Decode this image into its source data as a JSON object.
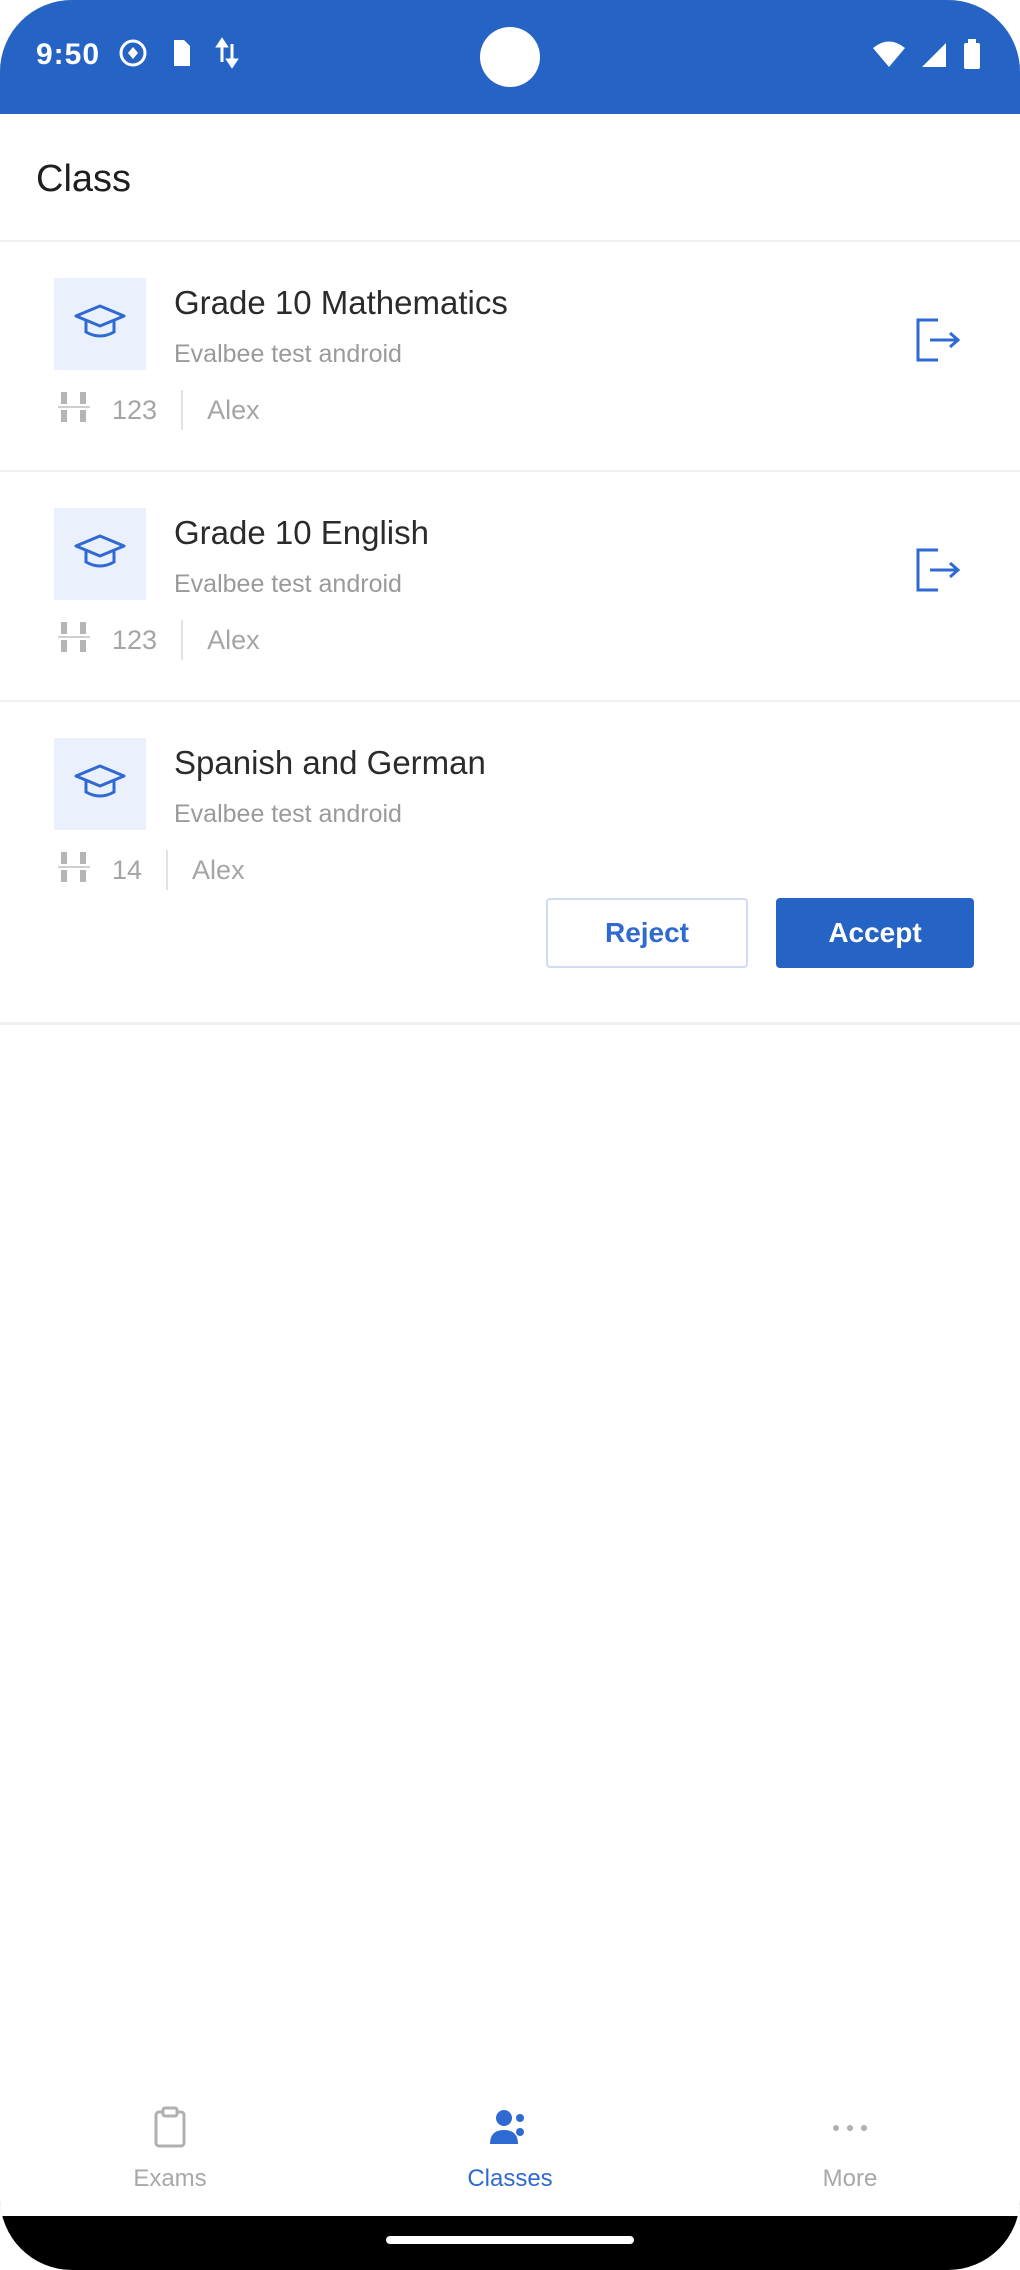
{
  "status_bar": {
    "time": "9:50",
    "bg_color": "#2563c4",
    "left_icons": [
      "vpn-icon",
      "sim-icon",
      "data-icon"
    ],
    "right_icons": [
      "wifi-icon",
      "signal-icon",
      "battery-icon"
    ]
  },
  "header": {
    "title": "Class"
  },
  "classes": [
    {
      "name": "Grade 10 Mathematics",
      "subtitle": "Evalbee test android",
      "count": "123",
      "teacher": "Alex",
      "action": "exit"
    },
    {
      "name": "Grade 10 English",
      "subtitle": "Evalbee test android",
      "count": "123",
      "teacher": "Alex",
      "action": "exit"
    },
    {
      "name": "Spanish and German",
      "subtitle": "Evalbee test android",
      "count": "14",
      "teacher": "Alex",
      "action": "invite",
      "reject_label": "Reject",
      "accept_label": "Accept"
    }
  ],
  "bottom_nav": {
    "items": [
      {
        "label": "Exams",
        "icon": "clipboard-icon",
        "active": false
      },
      {
        "label": "Classes",
        "icon": "people-icon",
        "active": true
      },
      {
        "label": "More",
        "icon": "more-dots-icon",
        "active": false
      }
    ]
  },
  "colors": {
    "primary": "#2563c4",
    "accent_text": "#2f6ad2",
    "icon_bg": "#eaf1fd",
    "muted_text": "#9a9a9a"
  }
}
